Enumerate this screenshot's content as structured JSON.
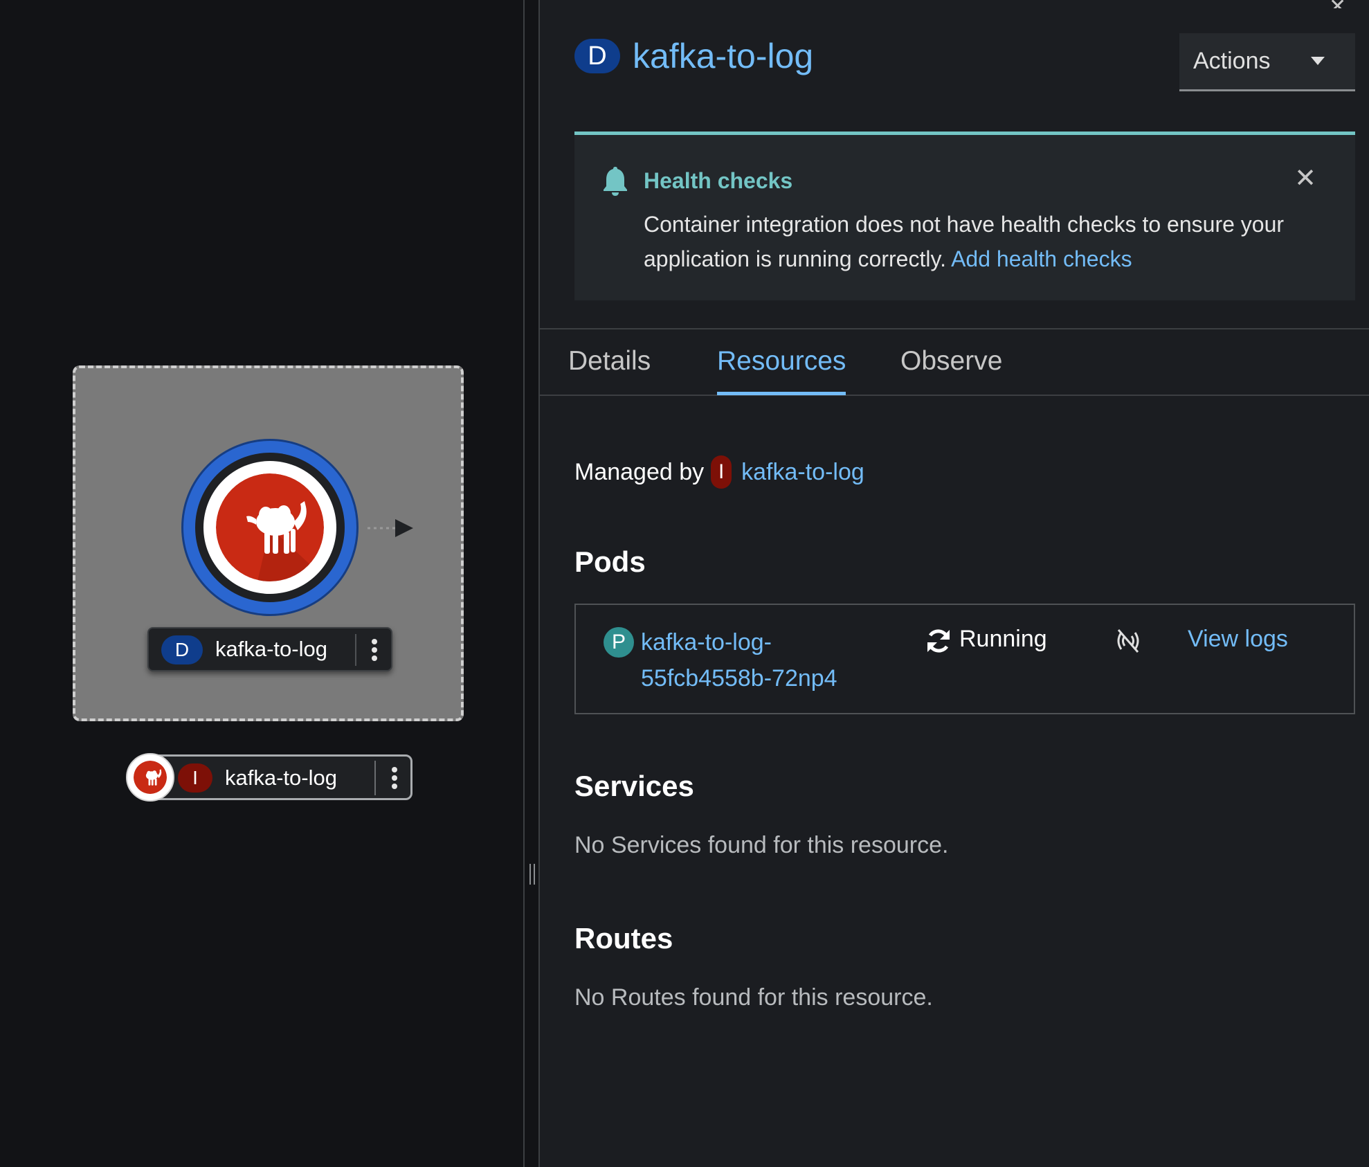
{
  "topology": {
    "deployment_node": {
      "badge": "D",
      "label": "kafka-to-log"
    },
    "integration_node": {
      "badge": "I",
      "label": "kafka-to-log"
    }
  },
  "panel": {
    "title_badge": "D",
    "title": "kafka-to-log",
    "actions_label": "Actions",
    "alert": {
      "title": "Health checks",
      "message": "Container integration does not have health checks to ensure your application is running correctly.",
      "link": "Add health checks"
    },
    "tabs": [
      {
        "label": "Details"
      },
      {
        "label": "Resources"
      },
      {
        "label": "Observe"
      }
    ],
    "active_tab": "Resources",
    "managed_by": {
      "label": "Managed by",
      "badge": "I",
      "link": "kafka-to-log"
    },
    "pods": {
      "title": "Pods",
      "items": [
        {
          "badge": "P",
          "name": "kafka-to-log-55fcb4558b-72np4",
          "status": "Running",
          "status_icon": "sync-icon",
          "network_icon": "network-off-icon",
          "logs_link": "View logs"
        }
      ]
    },
    "services": {
      "title": "Services",
      "empty": "No Services found for this resource."
    },
    "routes": {
      "title": "Routes",
      "empty": "No Routes found for this resource."
    }
  },
  "colors": {
    "link": "#73bcf7",
    "alert_accent": "#73c5c5",
    "deployment_badge": "#0f3d8c",
    "integration_badge": "#7d1007",
    "pod_badge": "#2f8f8f",
    "node_ring": "#2a66d0",
    "camel_red": "#c92a14"
  }
}
